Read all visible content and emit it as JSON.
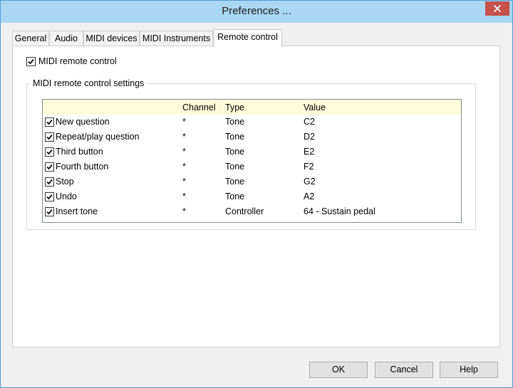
{
  "window": {
    "title": "Preferences ..."
  },
  "tabs": [
    {
      "label": "General"
    },
    {
      "label": "Audio"
    },
    {
      "label": "MIDI devices"
    },
    {
      "label": "MIDI Instruments"
    },
    {
      "label": "Remote control",
      "active": true
    }
  ],
  "panel": {
    "enable_label": "MIDI remote control",
    "enable_checked": true,
    "group_title": "MIDI remote control settings",
    "columns": [
      "",
      "Channel",
      "Type",
      "Value"
    ],
    "rows": [
      {
        "checked": true,
        "name": "New question",
        "channel": "*",
        "type": "Tone",
        "value": "C2"
      },
      {
        "checked": true,
        "name": "Repeat/play question",
        "channel": "*",
        "type": "Tone",
        "value": "D2"
      },
      {
        "checked": true,
        "name": "Third button",
        "channel": "*",
        "type": "Tone",
        "value": "E2"
      },
      {
        "checked": true,
        "name": "Fourth button",
        "channel": "*",
        "type": "Tone",
        "value": "F2"
      },
      {
        "checked": true,
        "name": "Stop",
        "channel": "*",
        "type": "Tone",
        "value": "G2"
      },
      {
        "checked": true,
        "name": "Undo",
        "channel": "*",
        "type": "Tone",
        "value": "A2"
      },
      {
        "checked": true,
        "name": "Insert tone",
        "channel": "*",
        "type": "Controller",
        "value": "64 - Sustain pedal"
      }
    ]
  },
  "buttons": {
    "ok": "OK",
    "cancel": "Cancel",
    "help": "Help"
  },
  "colors": {
    "titlebar": "#a9d7f3",
    "close": "#c7504a",
    "header_row": "#fdfbd9"
  },
  "icons": {
    "close": "close-icon",
    "check": "check-icon"
  }
}
